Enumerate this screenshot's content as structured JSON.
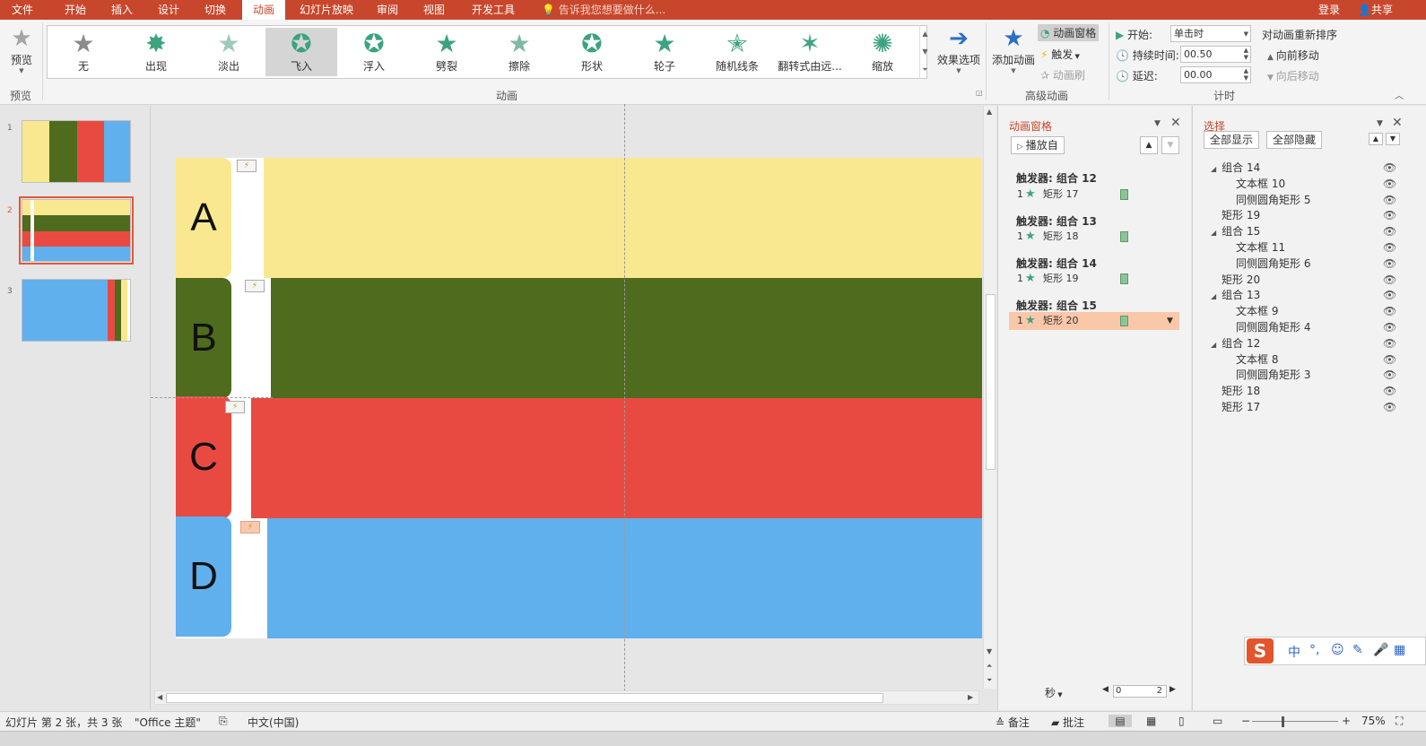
{
  "menu": {
    "tabs": [
      "文件",
      "开始",
      "插入",
      "设计",
      "切换",
      "动画",
      "幻灯片放映",
      "审阅",
      "视图",
      "开发工具"
    ],
    "active_tab": "动画",
    "tell_me": "告诉我您想要做什么...",
    "login": "登录",
    "share": "共享"
  },
  "ribbon": {
    "preview": {
      "label": "预览",
      "group_label": "预览"
    },
    "gallery": {
      "group_label": "动画",
      "items": [
        "无",
        "出现",
        "淡出",
        "飞入",
        "浮入",
        "劈裂",
        "擦除",
        "形状",
        "轮子",
        "随机线条",
        "翻转式由远...",
        "缩放"
      ],
      "selected": "飞入"
    },
    "effect_options": "效果选项",
    "advanced": {
      "group_label": "高级动画",
      "add_animation": "添加动画",
      "animation_pane": "动画窗格",
      "trigger": "触发",
      "painter": "动画刷"
    },
    "timing": {
      "group_label": "计时",
      "start_label": "开始:",
      "start_value": "单击时",
      "duration_label": "持续时间:",
      "duration_value": "00.50",
      "delay_label": "延迟:",
      "delay_value": "00.00",
      "reorder_title": "对动画重新排序",
      "move_earlier": "向前移动",
      "move_later": "向后移动"
    }
  },
  "thumbnails": [
    {
      "number": "1"
    },
    {
      "number": "2"
    },
    {
      "number": "3"
    }
  ],
  "slide": {
    "rows": [
      {
        "letter": "A",
        "color": "#f9e88f"
      },
      {
        "letter": "B",
        "color": "#4e6b1e"
      },
      {
        "letter": "C",
        "color": "#e84a42"
      },
      {
        "letter": "D",
        "color": "#60b0ee"
      }
    ]
  },
  "animation_pane": {
    "title": "动画窗格",
    "play_from": "播放自",
    "triggers": [
      {
        "label": "触发器:  组合 12",
        "item_number": "1",
        "item_name": "矩形  17"
      },
      {
        "label": "触发器:  组合 13",
        "item_number": "1",
        "item_name": "矩形  18"
      },
      {
        "label": "触发器:  组合 14",
        "item_number": "1",
        "item_name": "矩形  19"
      },
      {
        "label": "触发器:  组合 15",
        "item_number": "1",
        "item_name": "矩形  20"
      }
    ],
    "seconds_label": "秒",
    "timeline_start": "0",
    "timeline_end": "2"
  },
  "selection_pane": {
    "title": "选择",
    "show_all": "全部显示",
    "hide_all": "全部隐藏",
    "items": [
      {
        "name": "组合  14",
        "level": 0,
        "group": true
      },
      {
        "name": "文本框  10",
        "level": 1
      },
      {
        "name": "同侧圆角矩形  5",
        "level": 1
      },
      {
        "name": "矩形  19",
        "level": 0
      },
      {
        "name": "组合  15",
        "level": 0,
        "group": true
      },
      {
        "name": "文本框  11",
        "level": 1
      },
      {
        "name": "同侧圆角矩形  6",
        "level": 1
      },
      {
        "name": "矩形  20",
        "level": 0
      },
      {
        "name": "组合  13",
        "level": 0,
        "group": true
      },
      {
        "name": "文本框  9",
        "level": 1
      },
      {
        "name": "同侧圆角矩形  4",
        "level": 1
      },
      {
        "name": "组合  12",
        "level": 0,
        "group": true
      },
      {
        "name": "文本框  8",
        "level": 1
      },
      {
        "name": "同侧圆角矩形  3",
        "level": 1
      },
      {
        "name": "矩形  18",
        "level": 0
      },
      {
        "name": "矩形  17",
        "level": 0
      }
    ]
  },
  "ime": {
    "mode": "中"
  },
  "statusbar": {
    "slide_info": "幻灯片 第 2 张，共 3 张",
    "theme": "\"Office 主题\"",
    "language": "中文(中国)",
    "notes": "备注",
    "comments": "批注",
    "zoom": "75%"
  },
  "colors": {
    "accent": "#c8472c",
    "highlight": "#fbc7a9",
    "anim_star": "#3ca37f"
  }
}
